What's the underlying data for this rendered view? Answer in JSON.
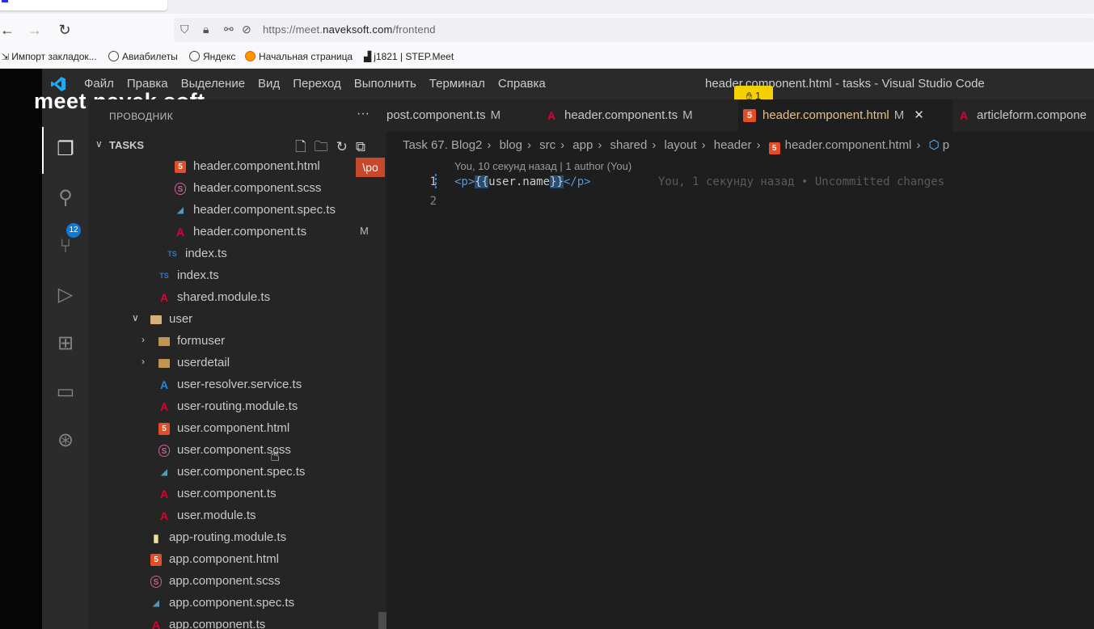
{
  "browser": {
    "url_prefix": "https://meet.",
    "url_domain": "naveksoft.com",
    "url_path": "/frontend",
    "bookmarks": [
      {
        "label": "Импорт закладок..."
      },
      {
        "label": "Авиабилеты"
      },
      {
        "label": "Яндекс"
      },
      {
        "label": "Начальная страница"
      },
      {
        "label": "j1821 | STEP.Meet"
      }
    ]
  },
  "overlay": {
    "brand": "meet  navek soft",
    "hand_count": "1"
  },
  "vscode": {
    "menu": [
      "Файл",
      "Правка",
      "Выделение",
      "Вид",
      "Переход",
      "Выполнить",
      "Терминал",
      "Справка"
    ],
    "window_title": "header.component.html - tasks - Visual Studio Code",
    "scm_badge": "12",
    "sidebar": {
      "title": "ПРОВОДНИК",
      "section": "TASKS",
      "tooltip": "\\po",
      "tree": [
        {
          "name": "header.component.html",
          "icon": "html-icon",
          "mod": ""
        },
        {
          "name": "header.component.scss",
          "icon": "scss-icon",
          "mod": ""
        },
        {
          "name": "header.component.spec.ts",
          "icon": "spec-icon",
          "mod": ""
        },
        {
          "name": "header.component.ts",
          "icon": "angular-icon",
          "mod": "M"
        },
        {
          "name": "index.ts",
          "icon": "ts-icon",
          "mod": ""
        },
        {
          "name": "index.ts",
          "icon": "ts-icon",
          "mod": ""
        },
        {
          "name": "shared.module.ts",
          "icon": "angular-icon",
          "mod": ""
        },
        {
          "name": "user",
          "icon": "folder-open-icon",
          "mod": ""
        },
        {
          "name": "formuser",
          "icon": "folder-icon",
          "mod": ""
        },
        {
          "name": "userdetail",
          "icon": "folder-icon",
          "mod": ""
        },
        {
          "name": "user-resolver.service.ts",
          "icon": "resolver-icon",
          "mod": ""
        },
        {
          "name": "user-routing.module.ts",
          "icon": "angular-icon",
          "mod": ""
        },
        {
          "name": "user.component.html",
          "icon": "html-icon",
          "mod": ""
        },
        {
          "name": "user.component.scss",
          "icon": "scss-icon",
          "mod": ""
        },
        {
          "name": "user.component.spec.ts",
          "icon": "spec-icon",
          "mod": ""
        },
        {
          "name": "user.component.ts",
          "icon": "angular-icon",
          "mod": ""
        },
        {
          "name": "user.module.ts",
          "icon": "angular-icon",
          "mod": ""
        },
        {
          "name": "app-routing.module.ts",
          "icon": "routing-icon",
          "mod": ""
        },
        {
          "name": "app.component.html",
          "icon": "html-icon",
          "mod": ""
        },
        {
          "name": "app.component.scss",
          "icon": "scss-icon",
          "mod": ""
        },
        {
          "name": "app.component.spec.ts",
          "icon": "spec-icon",
          "mod": ""
        },
        {
          "name": "app.component.ts",
          "icon": "angular-icon",
          "mod": ""
        }
      ]
    },
    "tabs": [
      {
        "label": "post.component.ts",
        "mod": "M"
      },
      {
        "label": "header.component.ts",
        "mod": "M"
      },
      {
        "label": "header.component.html",
        "mod": "M"
      },
      {
        "label": "articleform.compone",
        "mod": ""
      }
    ],
    "breadcrumbs": [
      "Task 67. Blog2",
      "blog",
      "src",
      "app",
      "shared",
      "layout",
      "header",
      "header.component.html",
      "p"
    ],
    "blame_header": "You, 10 секунд назад | 1 author (You)",
    "line_numbers": [
      "1",
      "2"
    ],
    "code": {
      "open_tag": "<p>",
      "brace_open": "{{",
      "expr": "user.name",
      "brace_close": "}}",
      "close_tag": "</p>"
    },
    "inline_blame": "You, 1 секунду назад • Uncommitted changes"
  }
}
